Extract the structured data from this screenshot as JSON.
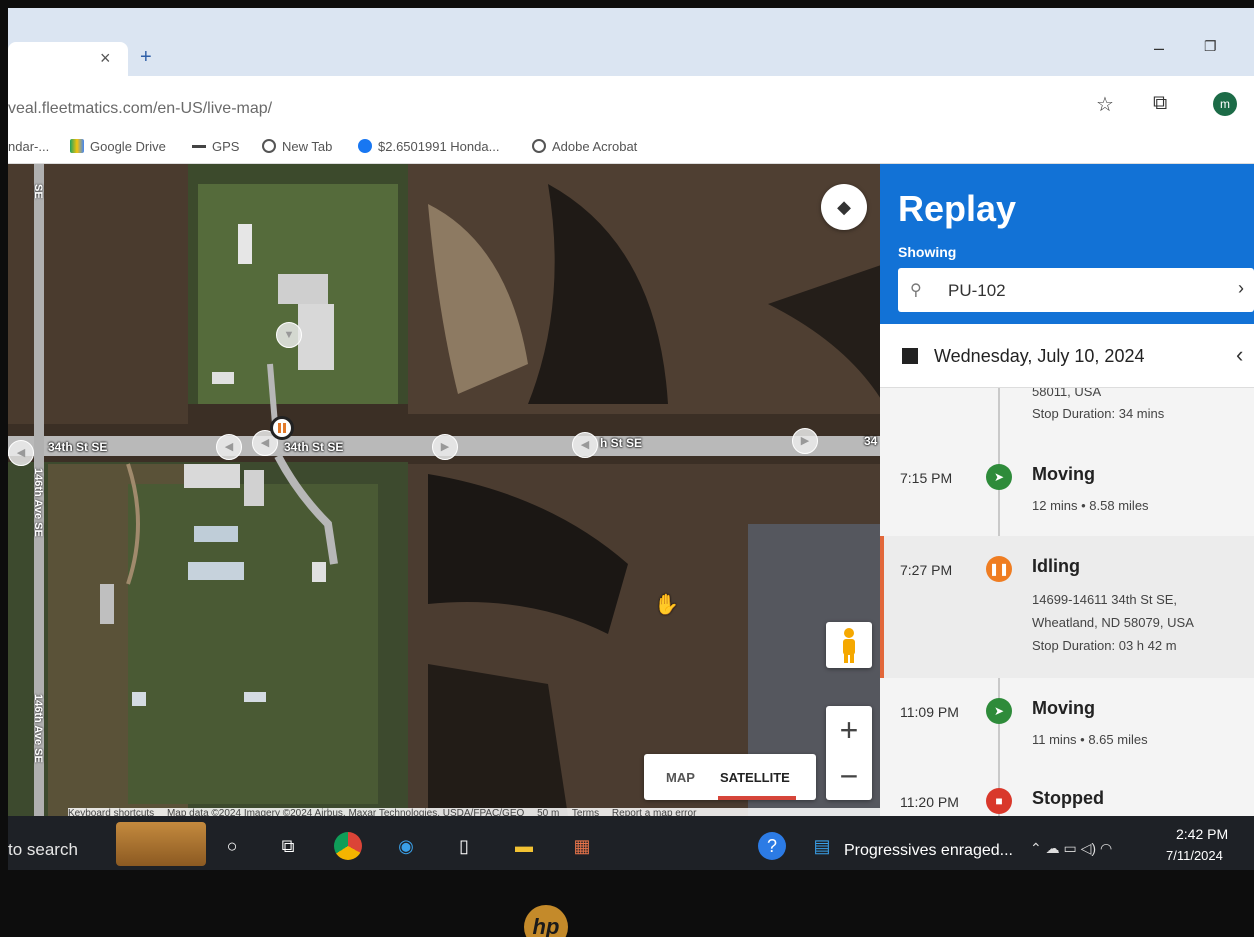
{
  "browser": {
    "url": "veal.fleetmatics.com/en-US/live-map/",
    "profile_initial": "m",
    "bookmarks": [
      {
        "label": "ndar-..."
      },
      {
        "label": "Google Drive"
      },
      {
        "label": "GPS"
      },
      {
        "label": "New Tab"
      },
      {
        "label": "$2.6501991 Honda..."
      },
      {
        "label": "Adobe Acrobat"
      }
    ]
  },
  "map": {
    "roads": {
      "main_left": "34th St SE",
      "main_center": "34th St SE",
      "main_right_fragment": "h St SE",
      "main_edge": "34",
      "vertical_top": "SE",
      "vertical_mid": "146th Ave SE",
      "vertical_low": "146th Ave SE"
    },
    "map_type": {
      "map_label": "MAP",
      "satellite_label": "SATELLITE",
      "active": "SATELLITE"
    },
    "footer": {
      "shortcuts": "Keyboard shortcuts",
      "attribution": "Map data ©2024 Imagery ©2024 Airbus, Maxar Technologies, USDA/FPAC/GEO",
      "scale": "50 m",
      "terms": "Terms",
      "report": "Report a map error"
    },
    "zoom_in": "+",
    "zoom_out": "−"
  },
  "panel": {
    "title": "Replay",
    "showing_label": "Showing",
    "vehicle": "PU-102",
    "date": "Wednesday, July 10, 2024",
    "events": [
      {
        "time": "",
        "title": "",
        "line1": "58011, USA",
        "line2": "Stop Duration: 34 mins",
        "status": "stop-end"
      },
      {
        "time": "7:15 PM",
        "title": "Moving",
        "line1": "12 mins • 8.58 miles",
        "status": "moving",
        "color": "#2e8b3a"
      },
      {
        "time": "7:27 PM",
        "title": "Idling",
        "line1": "14699-14611 34th St SE,",
        "line2": "Wheatland, ND 58079, USA",
        "line3": "Stop Duration: 03 h 42 m",
        "status": "idling",
        "color": "#ef7d22"
      },
      {
        "time": "11:09 PM",
        "title": "Moving",
        "line1": "11 mins • 8.65 miles",
        "status": "moving",
        "color": "#2e8b3a"
      },
      {
        "time": "11:20 PM",
        "title": "Stopped",
        "status": "stopped",
        "color": "#d9382b"
      }
    ]
  },
  "taskbar": {
    "search": "to search",
    "news": "Progressives enraged...",
    "time": "2:42 PM",
    "date": "7/11/2024"
  },
  "colors": {
    "accent": "#1272d6",
    "moving": "#2e8b3a",
    "idling": "#ef7d22",
    "stopped": "#d9382b"
  }
}
